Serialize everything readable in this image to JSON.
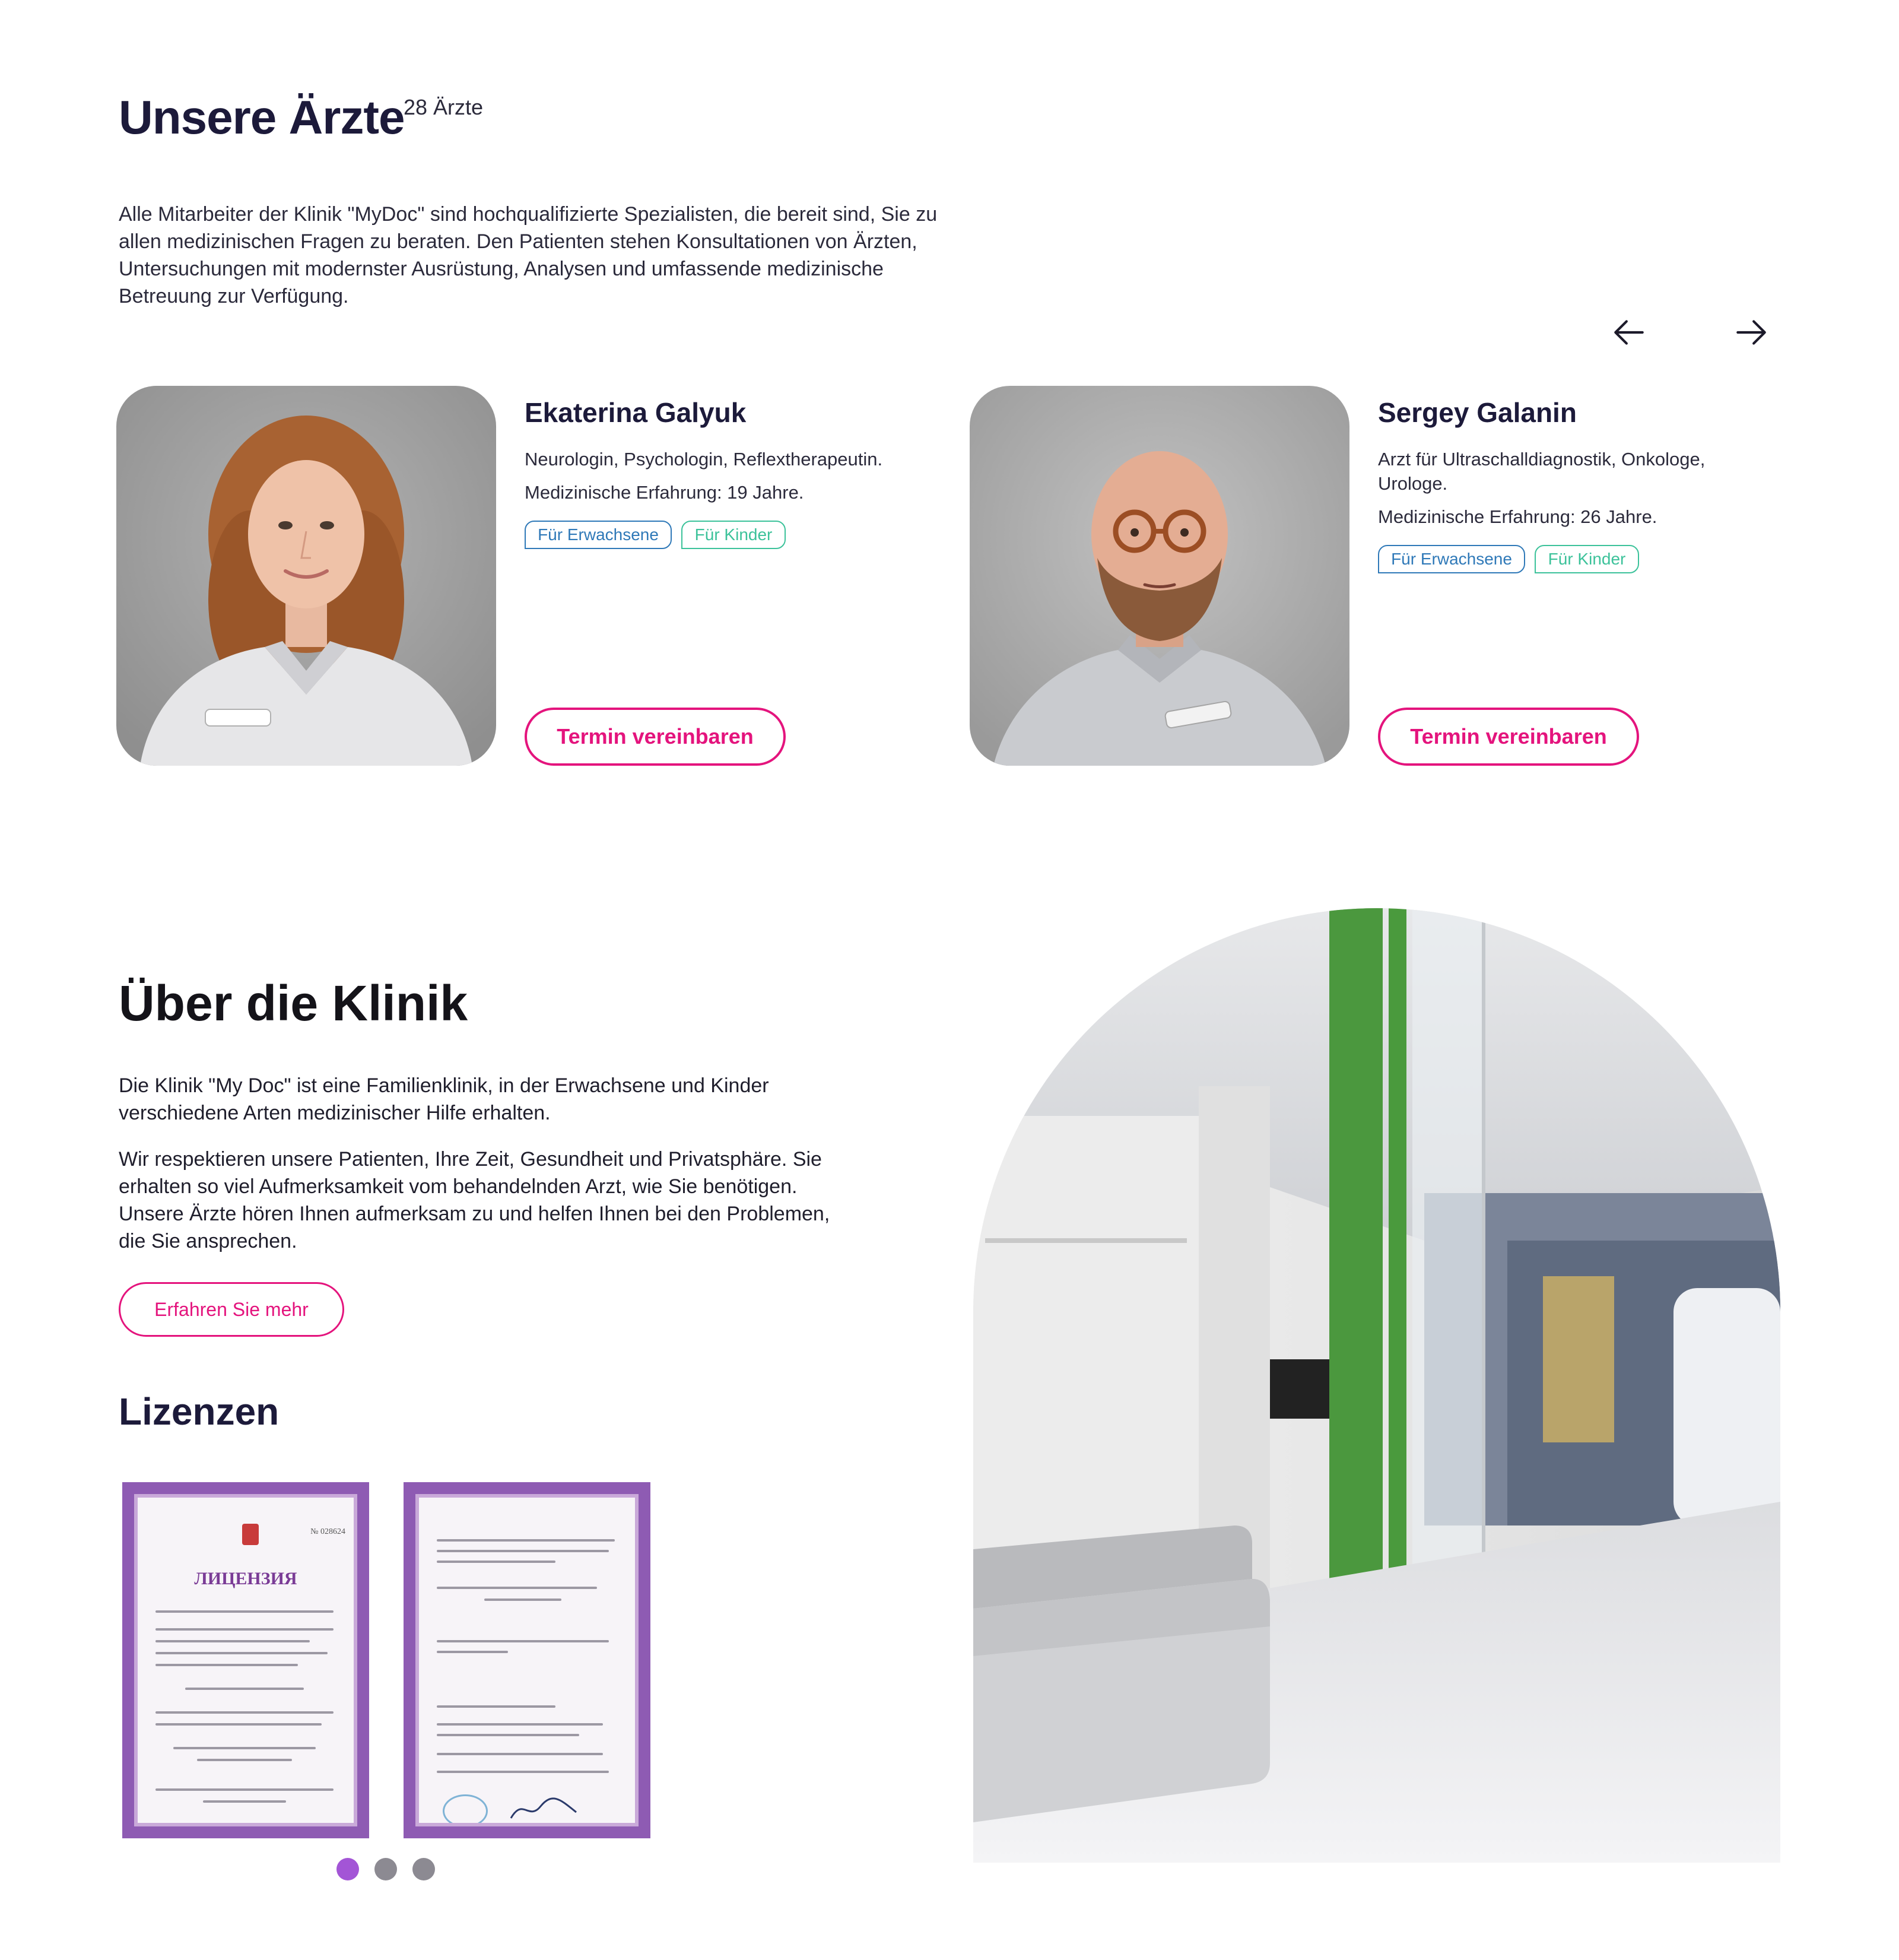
{
  "doctors": {
    "title": "Unsere Ärzte",
    "count": "28 Ärzte",
    "intro": "Alle Mitarbeiter der Klinik \"MyDoc\" sind hochqualifizierte Spezialisten, die bereit sind, Sie zu allen medizinischen Fragen zu beraten. Den Patienten stehen Konsultationen von Ärzten, Untersuchungen mit modernster Ausrüstung, Analysen und umfassende medizinische Betreuung zur Verfügung.",
    "prev_icon": "arrow-left-icon",
    "next_icon": "arrow-right-icon",
    "cards": [
      {
        "name": "Ekaterina Galyuk",
        "specialty": "Neurologin, Psychologin, Reflextherapeutin.",
        "experience": "Medizinische Erfahrung: 19 Jahre.",
        "tags": [
          "Für Erwachsene",
          "Für Kinder"
        ],
        "button": "Termin vereinbaren"
      },
      {
        "name": "Sergey Galanin",
        "specialty": "Arzt für Ultraschalldiagnostik, Onkologe, Urologe.",
        "experience": "Medizinische Erfahrung: 26 Jahre.",
        "tags": [
          "Für Erwachsene",
          "Für Kinder"
        ],
        "button": "Termin vereinbaren"
      }
    ]
  },
  "about": {
    "title": "Über die Klinik",
    "paragraph1": "Die Klinik \"My Doc\" ist eine Familienklinik, in der Erwachsene und Kinder verschiedene Arten medizinischer Hilfe erhalten.",
    "paragraph2": "Wir respektieren unsere Patienten, Ihre Zeit, Gesundheit und Privatsphäre. Sie erhalten so viel Aufmerksamkeit vom behandelnden Arzt, wie Sie benötigen. Unsere Ärzte hören Ihnen aufmerksam zu und helfen Ihnen bei den Problemen, die Sie ansprechen.",
    "button": "Erfahren Sie mehr"
  },
  "licenses": {
    "title": "Lizenzen",
    "doc1_heading": "ЛИЦЕНЗИЯ",
    "doc1_number": "№ 028624",
    "pagination": {
      "total": 3,
      "active": 0
    }
  },
  "colors": {
    "accent": "#e4147d",
    "tag_adult": "#2f79b8",
    "tag_kid": "#3cc29a",
    "dot_active": "#a355d6",
    "dot_inactive": "#8c8a92"
  }
}
